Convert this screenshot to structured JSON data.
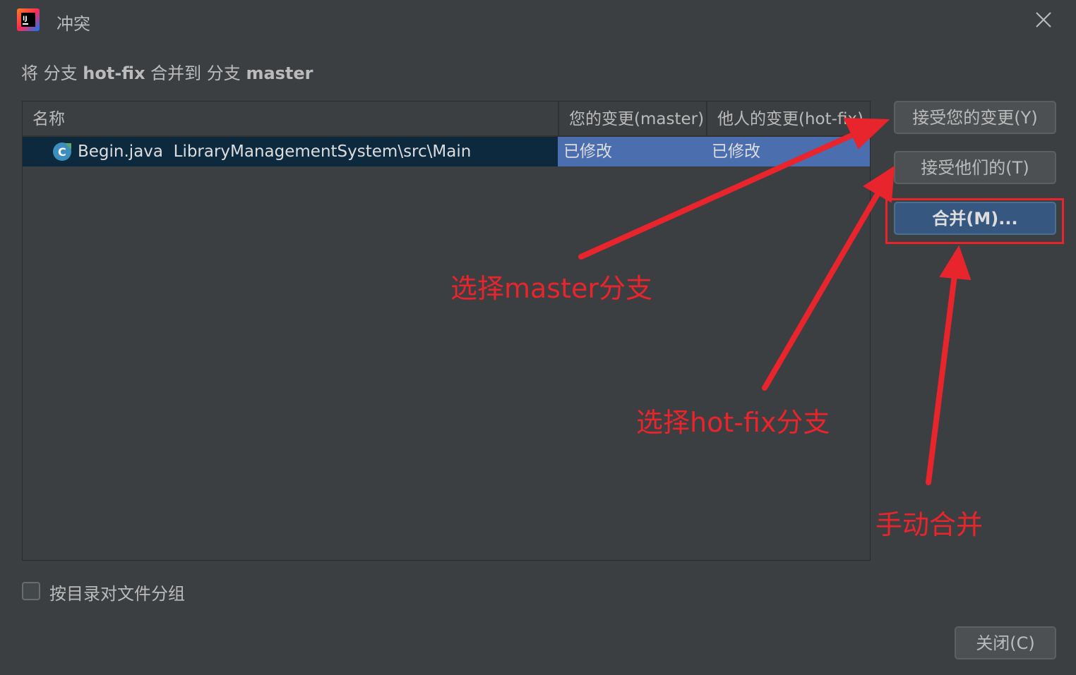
{
  "window": {
    "title": "冲突",
    "close_icon": "close-icon",
    "logo_icon": "intellij-idea-logo"
  },
  "subtitle": {
    "part1": "将 分支 ",
    "branch_from": "hot-fix",
    "part2": " 合并到 分支 ",
    "branch_to": "master"
  },
  "table": {
    "columns": [
      "名称",
      "您的变更(master)",
      "他人的变更(hot-fix)"
    ],
    "rows": [
      {
        "icon": "java-class-icon",
        "file": "Begin.java",
        "path": "LibraryManagementSystem\\src\\Main",
        "ours": "已修改",
        "theirs": "已修改"
      }
    ]
  },
  "buttons": {
    "accept_yours": "接受您的变更(Y)",
    "accept_theirs": "接受他们的(T)",
    "merge": "合并(M)...",
    "close": "关闭(C)"
  },
  "group_by_dir": {
    "label": "按目录对文件分组",
    "checked": false
  },
  "annotations": {
    "select_master": "选择master分支",
    "select_hotfix": "选择hot-fix分支",
    "manual_merge": "手动合并",
    "color": "#e8242c"
  },
  "colors": {
    "background": "#3c3f41",
    "selected_row": "#0d293e",
    "selected_cell": "#4b6eaf",
    "default_button": "#365880"
  }
}
